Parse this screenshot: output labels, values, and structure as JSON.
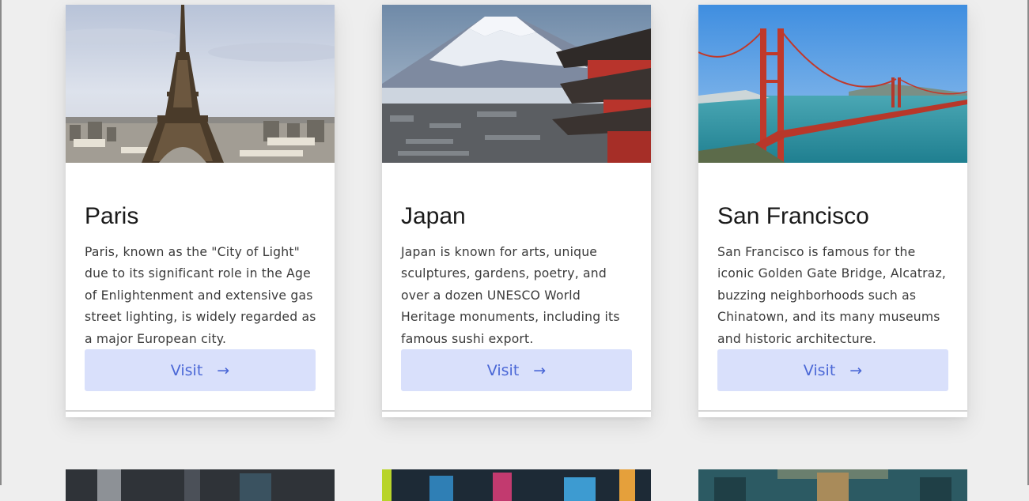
{
  "cards": [
    {
      "title": "Paris",
      "description": "Paris, known as the \"City of Light\" due to its significant role in the Age of Enlightenment and extensive gas street lighting, is widely regarded as a major European city.",
      "button_label": "Visit",
      "button_arrow": "→",
      "image": "eiffel-tower-photo"
    },
    {
      "title": "Japan",
      "description": "Japan is known for arts, unique sculptures, gardens, poetry, and over a dozen UNESCO World Heritage monuments, including its famous sushi export.",
      "button_label": "Visit",
      "button_arrow": "→",
      "image": "mount-fuji-pagoda-photo"
    },
    {
      "title": "San Francisco",
      "description": "San Francisco is famous for the iconic Golden Gate Bridge, Alcatraz, buzzing neighborhoods such as Chinatown, and its many museums and historic architecture.",
      "button_label": "Visit",
      "button_arrow": "→",
      "image": "golden-gate-bridge-photo"
    }
  ],
  "colors": {
    "page_background": "#eeeeee",
    "card_background": "#ffffff",
    "button_background": "#d9e0fb",
    "button_text": "#4a67d6"
  }
}
